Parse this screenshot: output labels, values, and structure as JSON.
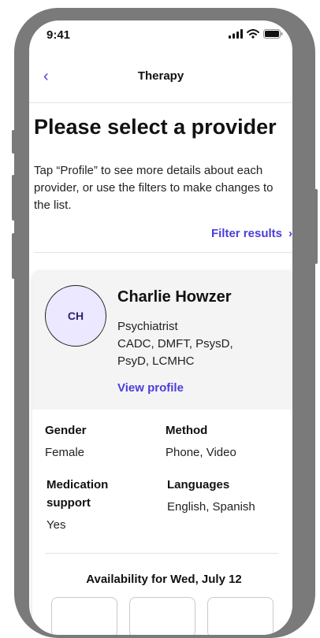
{
  "status_bar": {
    "time": "9:41",
    "icons": [
      "signal-icon",
      "wifi-icon",
      "battery-icon"
    ]
  },
  "nav": {
    "back_icon": "‹",
    "title": "Therapy"
  },
  "page": {
    "title": "Please select a provider",
    "description": "Tap “Profile” to see more details about each provider, or use the filters to make changes to the list.",
    "filter_label": "Filter results",
    "filter_chevron": "›"
  },
  "provider": {
    "initials": "CH",
    "name": "Charlie Howzer",
    "role": "Psychiatrist",
    "credentials": "CADC, DMFT, PsysD, PsyD, LCMHC",
    "view_profile_label": "View profile",
    "details": {
      "gender_label": "Gender",
      "gender_value": "Female",
      "method_label": "Method",
      "method_value": "Phone, Video",
      "medication_label": "Medication support",
      "medication_value": "Yes",
      "languages_label": "Languages",
      "languages_value": "English, Spanish"
    },
    "availability_title": "Availability for Wed, July 12"
  },
  "colors": {
    "accent": "#4b3ddb",
    "avatar_bg": "#ebe8ff",
    "card_header_bg": "#f4f4f4",
    "frame": "#7a7a7a"
  }
}
